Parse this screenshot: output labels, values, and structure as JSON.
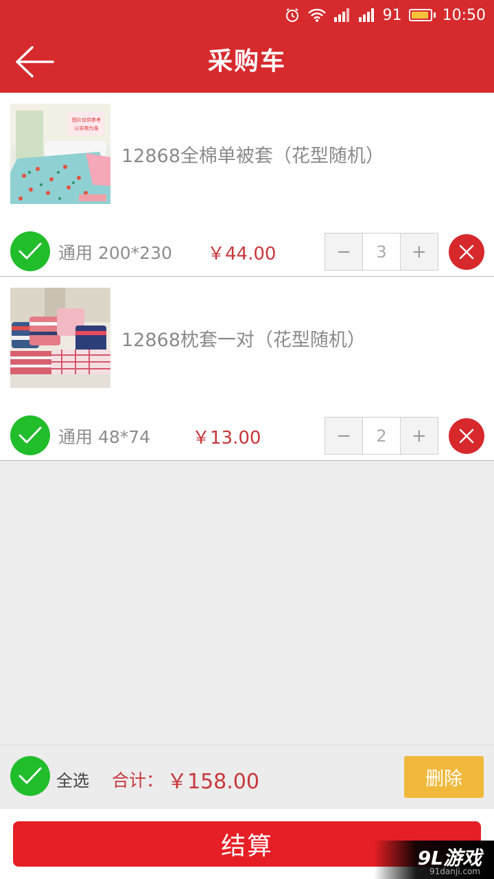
{
  "status_bar": {
    "signal_text": "91",
    "time": "10:50",
    "battery_level": 0.91,
    "icons": [
      "alarm-icon",
      "wifi-icon",
      "signal-icon",
      "signal-icon",
      "battery-icon"
    ]
  },
  "header": {
    "title": "采购车",
    "back_icon": "arrow-left-icon"
  },
  "items": [
    {
      "name": "12868全棉单被套（花型随机）",
      "spec": "通用 200*230",
      "price": "￥44.00",
      "quantity": "3",
      "checked": true
    },
    {
      "name": "12868枕套一对（花型随机）",
      "spec": "通用 48*74",
      "price": "￥13.00",
      "quantity": "2",
      "checked": true
    }
  ],
  "controls": {
    "minus": "−",
    "plus": "+"
  },
  "footer": {
    "select_all": "全选",
    "total_label": "合计：",
    "total_value": "￥158.00",
    "delete": "删除",
    "checkout": "结算"
  },
  "watermark": {
    "main": "9L游戏",
    "sub": "91danji.com"
  },
  "colors": {
    "primary_red": "#d72a2d",
    "check_green": "#21bd2b",
    "delete_yellow": "#f1b93b",
    "price_red": "#c8363a"
  }
}
